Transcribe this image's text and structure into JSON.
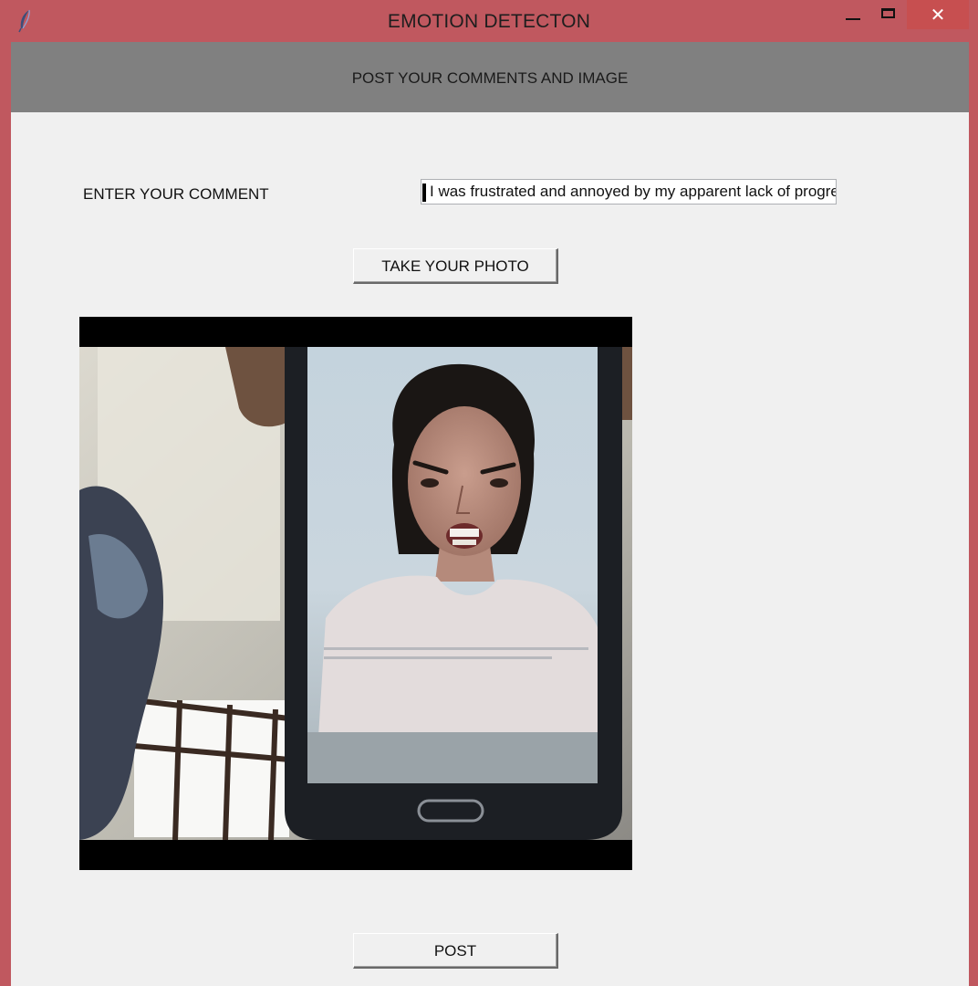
{
  "window": {
    "title": "EMOTION DETECTON",
    "app_icon": "feather-icon",
    "controls": {
      "minimize_icon": "minimize-icon",
      "maximize_icon": "maximize-icon",
      "close_glyph": "✕"
    },
    "frame_color": "#c0585f",
    "close_button_color": "#c74f50"
  },
  "header": {
    "text": "POST YOUR COMMENTS AND IMAGE",
    "background": "#808080"
  },
  "comment": {
    "label": "ENTER YOUR COMMENT",
    "value": "I was frustrated and annoyed by my apparent lack of progress"
  },
  "buttons": {
    "take_photo": "TAKE YOUR PHOTO",
    "post": "POST"
  },
  "photo": {
    "icon": "captured-photo-image"
  }
}
